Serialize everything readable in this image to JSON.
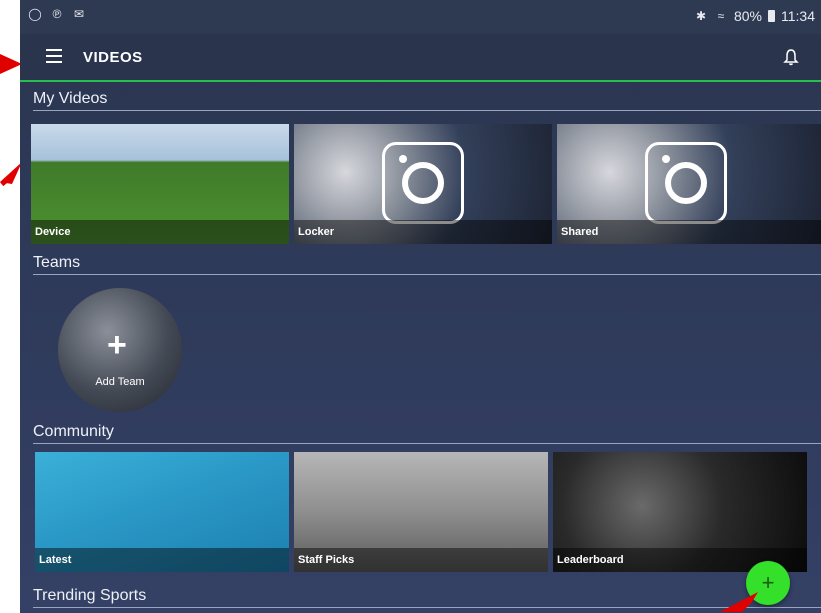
{
  "status_bar": {
    "left_icons": [
      "app-icon",
      "signal-icon",
      "mail-icon"
    ],
    "battery": "80%",
    "time": "11:34"
  },
  "app_bar": {
    "title": "VIDEOS"
  },
  "sections": {
    "my_videos": {
      "title": "My Videos",
      "tiles": [
        {
          "label": "Device"
        },
        {
          "label": "Locker"
        },
        {
          "label": "Shared"
        }
      ]
    },
    "teams": {
      "title": "Teams",
      "add_team_label": "Add Team"
    },
    "community": {
      "title": "Community",
      "tiles": [
        {
          "label": "Latest"
        },
        {
          "label": "Staff Picks"
        },
        {
          "label": "Leaderboard"
        }
      ]
    },
    "trending": {
      "title": "Trending Sports"
    }
  },
  "fab": {
    "symbol": "+"
  },
  "colors": {
    "accent": "#25c04f",
    "fab": "#35e02a",
    "background": "#2e3a56",
    "annotation_arrow": "#e00000"
  }
}
